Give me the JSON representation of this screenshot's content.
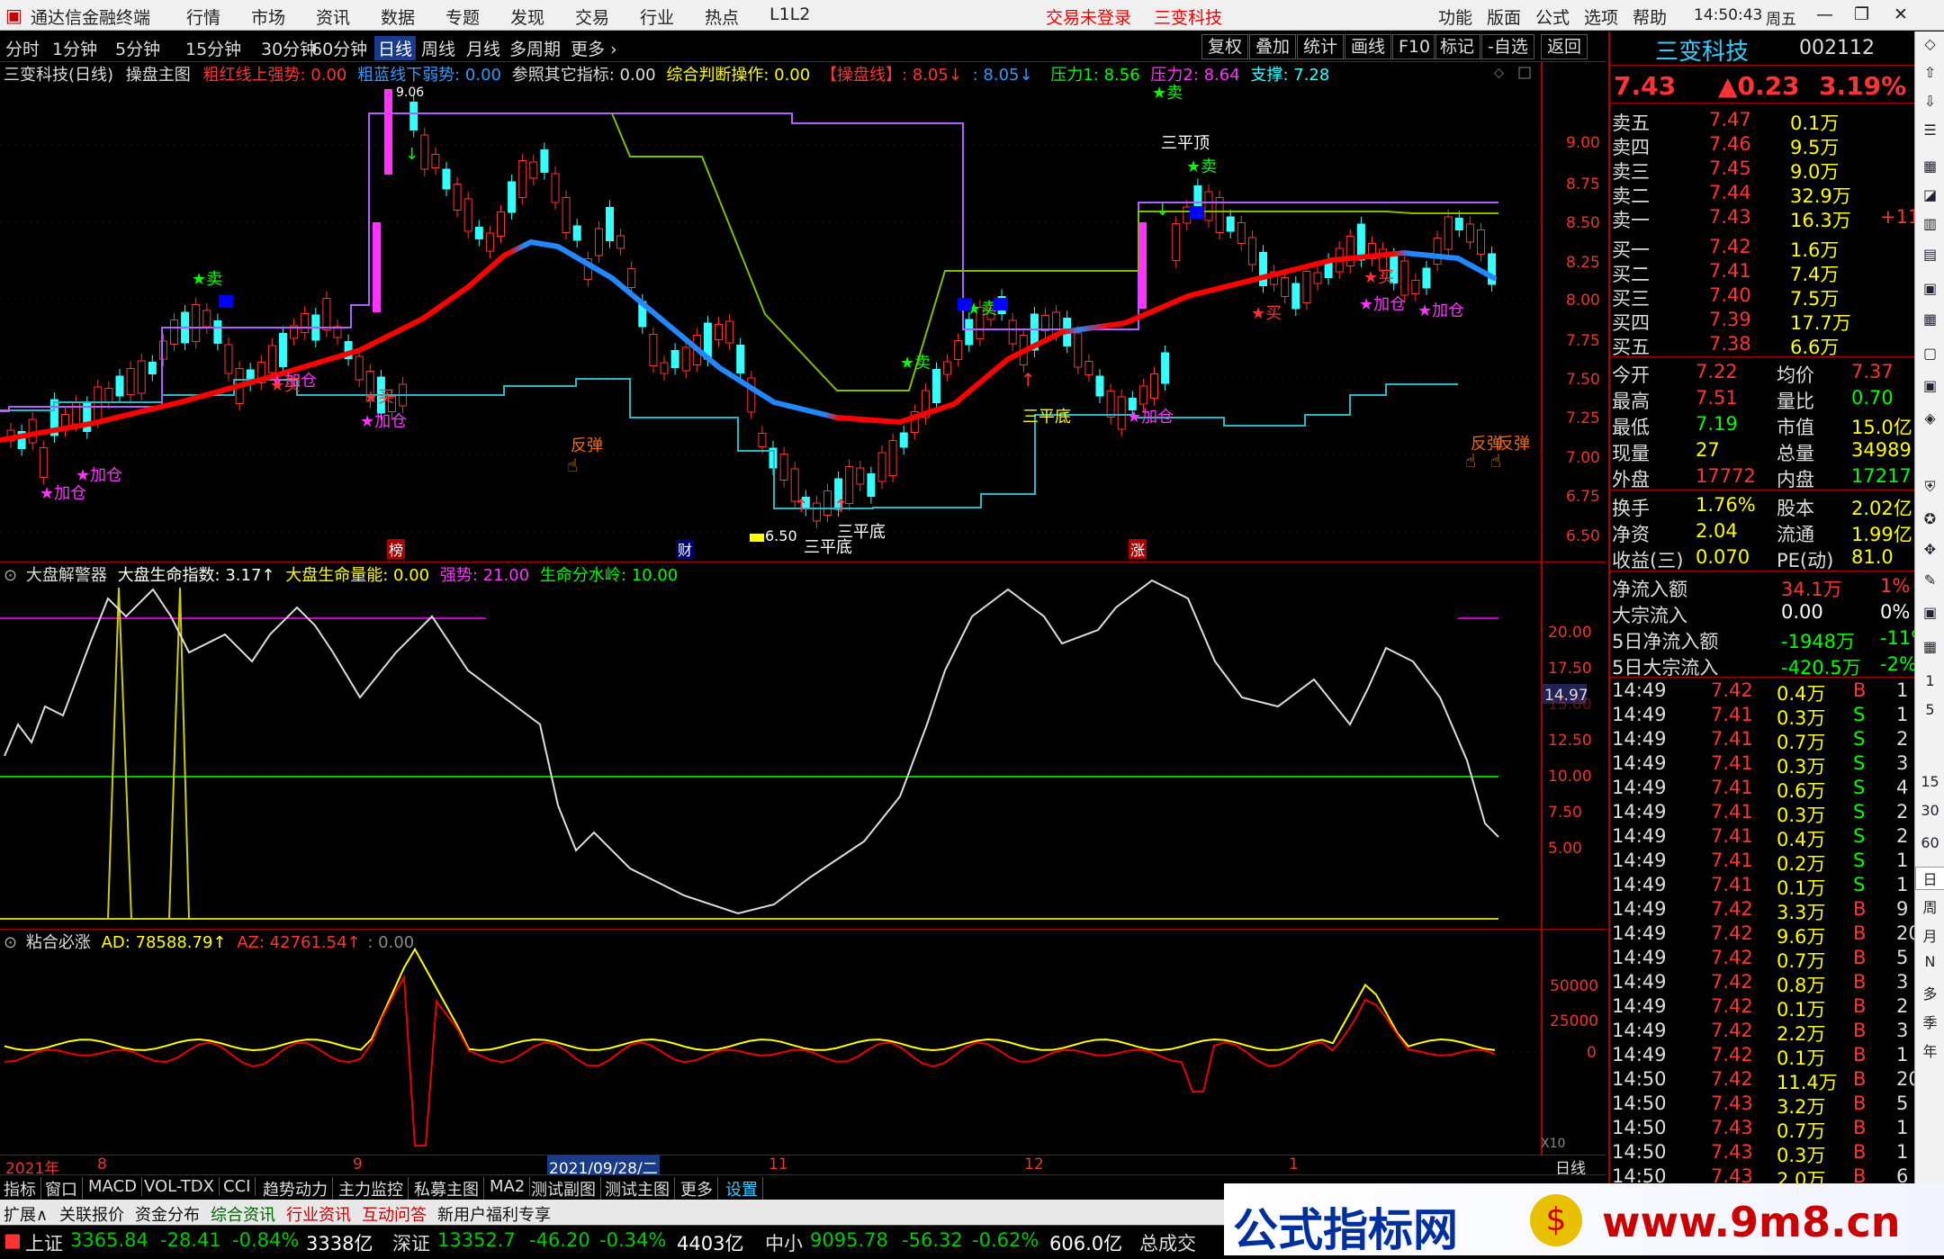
{
  "window": {
    "app_name": "通达信金融终端",
    "login_status": "交易未登录",
    "stock_title": "三变科技",
    "time": "14:50:43",
    "weekday": "周五"
  },
  "menu": [
    "行情",
    "市场",
    "资讯",
    "数据",
    "专题",
    "发现",
    "交易",
    "行业",
    "热点",
    "L1L2"
  ],
  "menu_right": [
    "功能",
    "版面",
    "公式",
    "选项",
    "帮助"
  ],
  "periods": [
    "分时",
    "1分钟",
    "5分钟",
    "15分钟",
    "30分钟",
    "60分钟",
    "日线",
    "周线",
    "月线",
    "多周期",
    "更多 ›"
  ],
  "tools": [
    "复权",
    "叠加",
    "统计",
    "画线",
    "F10",
    "标记",
    "-自选",
    "返回"
  ],
  "main_info": {
    "name": "三变科技(日线)",
    "formula": "操盘主图",
    "red_up": "粗红线上强势: 0.00",
    "blue_down": "粗蓝线下弱势: 0.00",
    "ref": "参照其它指标: 0.00",
    "judge": "综合判断操作: 0.00",
    "op_line": "【操盘线】: 8.05↓",
    "val2": ": 8.05↓",
    "press1": "压力1: 8.56",
    "press2": "压力2: 8.64",
    "support": "支撑: 7.28"
  },
  "main_axis": [
    "9.00",
    "8.75",
    "8.50",
    "8.25",
    "8.00",
    "7.75",
    "7.50",
    "7.25",
    "7.00",
    "6.75",
    "6.50"
  ],
  "main_labels": {
    "sell": "卖",
    "buy": "买",
    "add": "加仓",
    "rebound": "反弹",
    "three_bottom": "三平底",
    "three_top": "三平顶",
    "three_bottom2": "三平底",
    "low_price": "6.50",
    "high_price": "9.06",
    "tag_bang": "榜",
    "tag_cai": "财",
    "tag_zhang": "涨"
  },
  "ind1": {
    "name": "大盘解警器",
    "life": "大盘生命指数: 3.17↑",
    "energy": "大盘生命量能: 0.00",
    "strong": "强势: 21.00",
    "water": "生命分水岭: 10.00",
    "axis": [
      "20.00",
      "17.50",
      "15.00",
      "12.50",
      "10.00",
      "7.50",
      "5.00"
    ],
    "current": "14.97"
  },
  "ind2": {
    "name": "粘合必涨",
    "ad": "AD: 78588.79↑",
    "az": "AZ: 42761.54↑",
    "zero": ": 0.00",
    "axis": [
      "50000",
      "25000",
      "0"
    ],
    "x10": "X10"
  },
  "x_axis": {
    "labels": [
      "2021年",
      "8",
      "9",
      "2021/09/28/二",
      "11",
      "12",
      "1"
    ],
    "period": "日线"
  },
  "quote": {
    "name": "三变科技",
    "code": "002112",
    "price": "7.43",
    "change": "▲0.23",
    "pct": "3.19%",
    "asks": [
      [
        "卖五",
        "7.47",
        "0.1万"
      ],
      [
        "卖四",
        "7.46",
        "9.5万"
      ],
      [
        "卖三",
        "7.45",
        "9.0万"
      ],
      [
        "卖二",
        "7.44",
        "32.9万"
      ],
      [
        "卖一",
        "7.43",
        "16.3万"
      ]
    ],
    "ask_extra": "+11",
    "bids": [
      [
        "买一",
        "7.42",
        "1.6万"
      ],
      [
        "买二",
        "7.41",
        "7.4万"
      ],
      [
        "买三",
        "7.40",
        "7.5万"
      ],
      [
        "买四",
        "7.39",
        "17.7万"
      ],
      [
        "买五",
        "7.38",
        "6.6万"
      ]
    ],
    "stats": [
      [
        "今开",
        "7.22",
        "均价",
        "7.37"
      ],
      [
        "最高",
        "7.51",
        "量比",
        "0.70"
      ],
      [
        "最低",
        "7.19",
        "市值",
        "15.0亿"
      ],
      [
        "现量",
        "27",
        "总量",
        "34989"
      ],
      [
        "外盘",
        "17772",
        "内盘",
        "17217"
      ]
    ],
    "stats2": [
      [
        "换手",
        "1.76%",
        "股本",
        "2.02亿"
      ],
      [
        "净资",
        "2.04",
        "流通",
        "1.99亿"
      ],
      [
        "收益(三)",
        "0.070",
        "PE(动)",
        "81.0"
      ]
    ],
    "flows": [
      [
        "净流入额",
        "34.1万",
        "1%"
      ],
      [
        "大宗流入",
        "0.00",
        "0%"
      ],
      [
        "5日净流入额",
        "-1948万",
        "-11%"
      ],
      [
        "5日大宗流入",
        "-420.5万",
        "-2%"
      ]
    ]
  },
  "ticks": [
    [
      "14:49",
      "7.42",
      "0.4万",
      "B",
      "1"
    ],
    [
      "14:49",
      "7.41",
      "0.3万",
      "S",
      "1"
    ],
    [
      "14:49",
      "7.41",
      "0.7万",
      "S",
      "2"
    ],
    [
      "14:49",
      "7.41",
      "0.3万",
      "S",
      "3"
    ],
    [
      "14:49",
      "7.41",
      "0.6万",
      "S",
      "4"
    ],
    [
      "14:49",
      "7.41",
      "0.3万",
      "S",
      "2"
    ],
    [
      "14:49",
      "7.41",
      "0.4万",
      "S",
      "2"
    ],
    [
      "14:49",
      "7.41",
      "0.2万",
      "S",
      "1"
    ],
    [
      "14:49",
      "7.41",
      "0.1万",
      "S",
      "1"
    ],
    [
      "14:49",
      "7.42",
      "3.3万",
      "B",
      "9"
    ],
    [
      "14:49",
      "7.42",
      "9.6万",
      "B",
      "20"
    ],
    [
      "14:49",
      "7.42",
      "0.7万",
      "B",
      "5"
    ],
    [
      "14:49",
      "7.42",
      "0.8万",
      "B",
      "3"
    ],
    [
      "14:49",
      "7.42",
      "0.1万",
      "B",
      "2"
    ],
    [
      "14:49",
      "7.42",
      "2.2万",
      "B",
      "3"
    ],
    [
      "14:49",
      "7.42",
      "0.1万",
      "B",
      "1"
    ],
    [
      "14:50",
      "7.42",
      "11.4万",
      "B",
      "20"
    ],
    [
      "14:50",
      "7.43",
      "3.2万",
      "B",
      "5"
    ],
    [
      "14:50",
      "7.43",
      "0.7万",
      "B",
      "1"
    ],
    [
      "14:50",
      "7.43",
      "0.3万",
      "B",
      "1"
    ],
    [
      "14:50",
      "7.43",
      "2.0万",
      "B",
      "6"
    ]
  ],
  "sidebar": [
    "日",
    "周",
    "月",
    "N",
    "多",
    "季",
    "年"
  ],
  "sidebar_nums": [
    "1",
    "5",
    "15",
    "30",
    "60"
  ],
  "bottom_tabs": [
    "指标",
    "窗口",
    "MACD",
    "VOL-TDX",
    "CCI",
    "趋势动力",
    "主力监控",
    "私募主图",
    "MA2",
    "测试副图",
    "测试主图",
    "更多",
    "设置"
  ],
  "bottom_tabs2": [
    "扩展∧",
    "关联报价",
    "资金分布",
    "综合资讯",
    "行业资讯",
    "互动问答",
    "新用户福利专享"
  ],
  "status": {
    "sh_label": "上证",
    "sh_val": "3365.84",
    "sh_chg": "-28.41",
    "sh_pct": "-0.84%",
    "sh_amt": "3338亿",
    "sz_label": "深证",
    "sz_val": "13352.7",
    "sz_chg": "-46.20",
    "sz_pct": "-0.34%",
    "sz_amt": "4403亿",
    "zx_label": "中小",
    "zx_val": "9095.78",
    "zx_chg": "-56.32",
    "zx_pct": "-0.62%",
    "zx_amt": "606.0亿",
    "total": "总成交"
  },
  "brand": {
    "text": "公式指标网",
    "url": "www.9m8.cn"
  }
}
